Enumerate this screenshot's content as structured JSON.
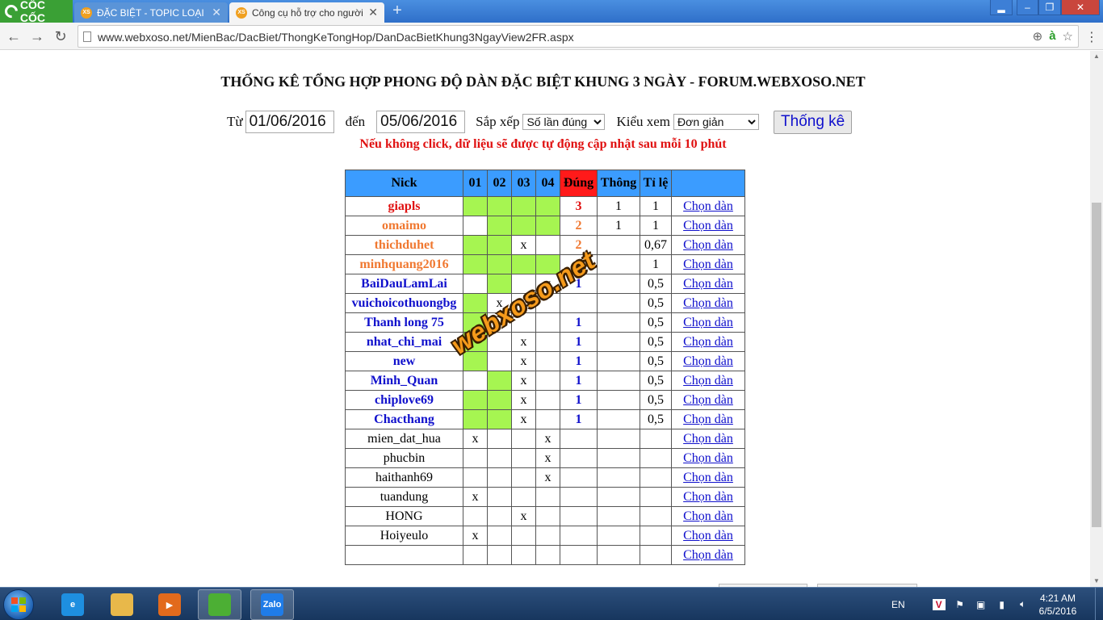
{
  "browser": {
    "logo": "CỐC CỐC",
    "tabs": [
      {
        "favicon": "XS",
        "title": "ĐẶC BIỆT - TOPIC LOẠI ĐẶ",
        "active": false
      },
      {
        "favicon": "XS",
        "title": "Công cụ hỗ trợ cho người",
        "active": true
      }
    ],
    "url": "www.webxoso.net/MienBac/DacBiet/ThongKeTongHop/DanDacBietKhung3NgayView2FR.aspx",
    "icons": [
      "back-icon",
      "forward-icon",
      "reload-icon",
      "page-icon",
      "zoom-icon",
      "coccoc-a-icon",
      "star-icon",
      "menu-icon"
    ]
  },
  "page": {
    "title": "THỐNG KÊ TỔNG HỢP PHONG ĐỘ DÀN ĐẶC BIỆT KHUNG 3 NGÀY - FORUM.WEBXOSO.NET",
    "filters": {
      "from_label": "Từ",
      "from_value": "01/06/2016",
      "to_label": "đến",
      "to_value": "05/06/2016",
      "sort_label": "Sắp xếp",
      "sort_value": "Số lần đúng",
      "view_label": "Kiểu xem",
      "view_value": "Đơn giản",
      "submit_label": "Thống kê"
    },
    "notice": "Nếu không click, dữ liệu sẽ được tự động cập nhật sau mỗi 10 phút",
    "watermark": "webxoso.net"
  },
  "table": {
    "headers": [
      "Nick",
      "01",
      "02",
      "03",
      "04",
      "Đúng",
      "Thông",
      "Tỉ lệ",
      ""
    ],
    "link_label": "Chọn dàn",
    "colors": {
      "header": "#3b9cff",
      "highlight": "#ff1a1a",
      "hit": "#a6f551",
      "red": "#e01010",
      "orange": "#f07830",
      "blue": "#1010cc"
    },
    "rows": [
      {
        "nick": "giapls",
        "color": "#e01010",
        "days": [
          "g",
          "g",
          "g",
          "g"
        ],
        "dung": "3",
        "thong": "1",
        "tile": "1"
      },
      {
        "nick": "omaimo",
        "color": "#f07830",
        "days": [
          "",
          "g",
          "g",
          "g"
        ],
        "dung": "2",
        "thong": "1",
        "tile": "1"
      },
      {
        "nick": "thichduhet",
        "color": "#f07830",
        "days": [
          "g",
          "g",
          "x",
          ""
        ],
        "dung": "2",
        "thong": "",
        "tile": "0,67"
      },
      {
        "nick": "minhquang2016",
        "color": "#f07830",
        "days": [
          "g",
          "g",
          "g",
          "g"
        ],
        "dung": "2",
        "thong": "",
        "tile": "1"
      },
      {
        "nick": "BaiDauLamLai",
        "color": "#1010cc",
        "days": [
          "",
          "g",
          "",
          "x"
        ],
        "dung": "1",
        "thong": "",
        "tile": "0,5"
      },
      {
        "nick": "vuichoicothuongbg",
        "color": "#1010cc",
        "days": [
          "g",
          "x",
          "",
          ""
        ],
        "dung": "",
        "thong": "",
        "tile": "0,5"
      },
      {
        "nick": "Thanh long 75",
        "color": "#1010cc",
        "days": [
          "g",
          "",
          "",
          ""
        ],
        "dung": "1",
        "thong": "",
        "tile": "0,5"
      },
      {
        "nick": "nhat_chi_mai",
        "color": "#1010cc",
        "days": [
          "g",
          "",
          "x",
          ""
        ],
        "dung": "1",
        "thong": "",
        "tile": "0,5"
      },
      {
        "nick": "new",
        "color": "#1010cc",
        "days": [
          "g",
          "",
          "x",
          ""
        ],
        "dung": "1",
        "thong": "",
        "tile": "0,5"
      },
      {
        "nick": "Minh_Quan",
        "color": "#1010cc",
        "days": [
          "",
          "g",
          "x",
          ""
        ],
        "dung": "1",
        "thong": "",
        "tile": "0,5"
      },
      {
        "nick": "chiplove69",
        "color": "#1010cc",
        "days": [
          "g",
          "g",
          "x",
          ""
        ],
        "dung": "1",
        "thong": "",
        "tile": "0,5"
      },
      {
        "nick": "Chacthang",
        "color": "#1010cc",
        "days": [
          "g",
          "g",
          "x",
          ""
        ],
        "dung": "1",
        "thong": "",
        "tile": "0,5"
      },
      {
        "nick": "mien_dat_hua",
        "color": "",
        "days": [
          "x",
          "",
          "",
          "x"
        ],
        "dung": "",
        "thong": "",
        "tile": ""
      },
      {
        "nick": "phucbin",
        "color": "",
        "days": [
          "",
          "",
          "",
          "x"
        ],
        "dung": "",
        "thong": "",
        "tile": ""
      },
      {
        "nick": "haithanh69",
        "color": "",
        "days": [
          "",
          "",
          "",
          "x"
        ],
        "dung": "",
        "thong": "",
        "tile": ""
      },
      {
        "nick": "tuandung",
        "color": "",
        "days": [
          "x",
          "",
          "",
          ""
        ],
        "dung": "",
        "thong": "",
        "tile": ""
      },
      {
        "nick": "HONG",
        "color": "",
        "days": [
          "",
          "",
          "x",
          ""
        ],
        "dung": "",
        "thong": "",
        "tile": ""
      },
      {
        "nick": "Hoiyeulo",
        "color": "",
        "days": [
          "x",
          "",
          "",
          ""
        ],
        "dung": "",
        "thong": "",
        "tile": ""
      },
      {
        "nick": "",
        "color": "",
        "days": [
          "",
          "",
          "",
          ""
        ],
        "dung": "",
        "thong": "",
        "tile": ""
      }
    ]
  },
  "taskbar": {
    "apps": [
      {
        "name": "ie-icon",
        "label": "e",
        "color": "#1e8fe0"
      },
      {
        "name": "explorer-icon",
        "label": "",
        "color": "#e8b84a"
      },
      {
        "name": "media-player-icon",
        "label": "▶",
        "color": "#e26a1c"
      },
      {
        "name": "coccoc-icon",
        "label": "",
        "color": "#4caf34"
      },
      {
        "name": "zalo-icon",
        "label": "Zalo",
        "color": "#1f7ce8"
      }
    ],
    "lang": "EN",
    "time": "4:21 AM",
    "date": "6/5/2016"
  }
}
